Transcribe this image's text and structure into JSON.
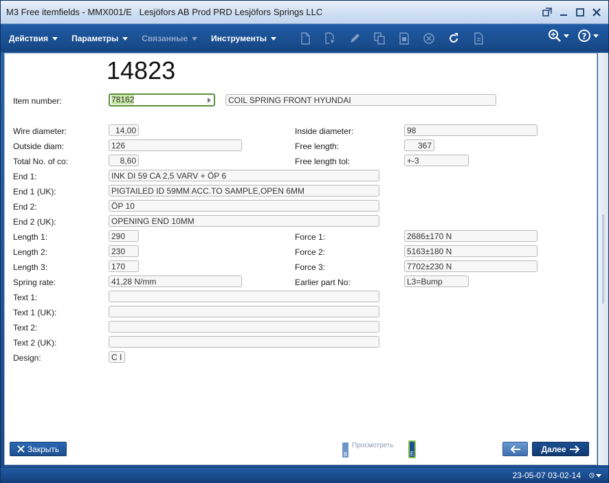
{
  "window": {
    "title": "M3 Free itemfields - MMX001/E   Lesjöfors AB Prod PRD Lesjöfors Springs LLC"
  },
  "toolbar": {
    "menus": [
      {
        "label": "Действия",
        "enabled": true
      },
      {
        "label": "Параметры",
        "enabled": true
      },
      {
        "label": "Связанные",
        "enabled": false
      },
      {
        "label": "Инструменты",
        "enabled": true
      }
    ],
    "icons": [
      "new-document-icon",
      "copy-cursor-icon",
      "edit-pencil-icon",
      "copy-pages-icon",
      "open-doc-icon",
      "delete-circle-icon",
      "refresh-icon",
      "page-icon"
    ]
  },
  "header": {
    "number": "14823"
  },
  "form": {
    "item_number_label": "Item number:",
    "item_number_value": "78162",
    "item_description": "COIL SPRING FRONT HYUNDAI",
    "wire_diameter_label": "Wire diameter:",
    "wire_diameter_value": "14,00",
    "inside_diameter_label": "Inside diameter:",
    "inside_diameter_value": "98",
    "outside_diam_label": "Outside diam:",
    "outside_diam_value": "126",
    "free_length_label": "Free length:",
    "free_length_value": "367",
    "total_no_label": "Total No. of co:",
    "total_no_value": "8,60",
    "free_length_tol_label": "Free length tol:",
    "free_length_tol_value": "+-3",
    "end1_label": "End 1:",
    "end1_value": "INK DI 59 CA 2,5 VARV + ÖP 6",
    "end1_uk_label": "End 1 (UK):",
    "end1_uk_value": "PIGTAILED ID 59MM ACC.TO SAMPLE,OPEN 6MM",
    "end2_label": "End 2:",
    "end2_value": "ÖP 10",
    "end2_uk_label": "End 2 (UK):",
    "end2_uk_value": "OPENING END 10MM",
    "length1_label": "Length 1:",
    "length1_value": "290",
    "force1_label": "Force 1:",
    "force1_value": "2686±170 N",
    "length2_label": "Length 2:",
    "length2_value": "230",
    "force2_label": "Force 2:",
    "force2_value": "5163±180 N",
    "length3_label": "Length 3:",
    "length3_value": "170",
    "force3_label": "Force 3:",
    "force3_value": "7702±230 N",
    "spring_rate_label": "Spring rate:",
    "spring_rate_value": "41,28 N/mm",
    "earlier_part_label": "Earlier part No:",
    "earlier_part_value": "L3=Bump",
    "text1_label": "Text 1:",
    "text1_value": "",
    "text1_uk_label": "Text 1 (UK):",
    "text1_uk_value": "",
    "text2_label": "Text 2:",
    "text2_value": "",
    "text2_uk_label": "Text 2 (UK):",
    "text2_uk_value": "",
    "design_label": "Design:",
    "design_value": "C I"
  },
  "footer": {
    "close_label": "Закрыть",
    "preview_label": "Просмотреть",
    "preview_b": "B",
    "preview_e": "E",
    "next_label": "Далее"
  },
  "status": {
    "timestamp": "23-05-07 03-02-14"
  },
  "colors": {
    "toolbar": "#1f5aa4",
    "active_field_border": "#5b8f3a",
    "selection": "#c9e7a7"
  }
}
